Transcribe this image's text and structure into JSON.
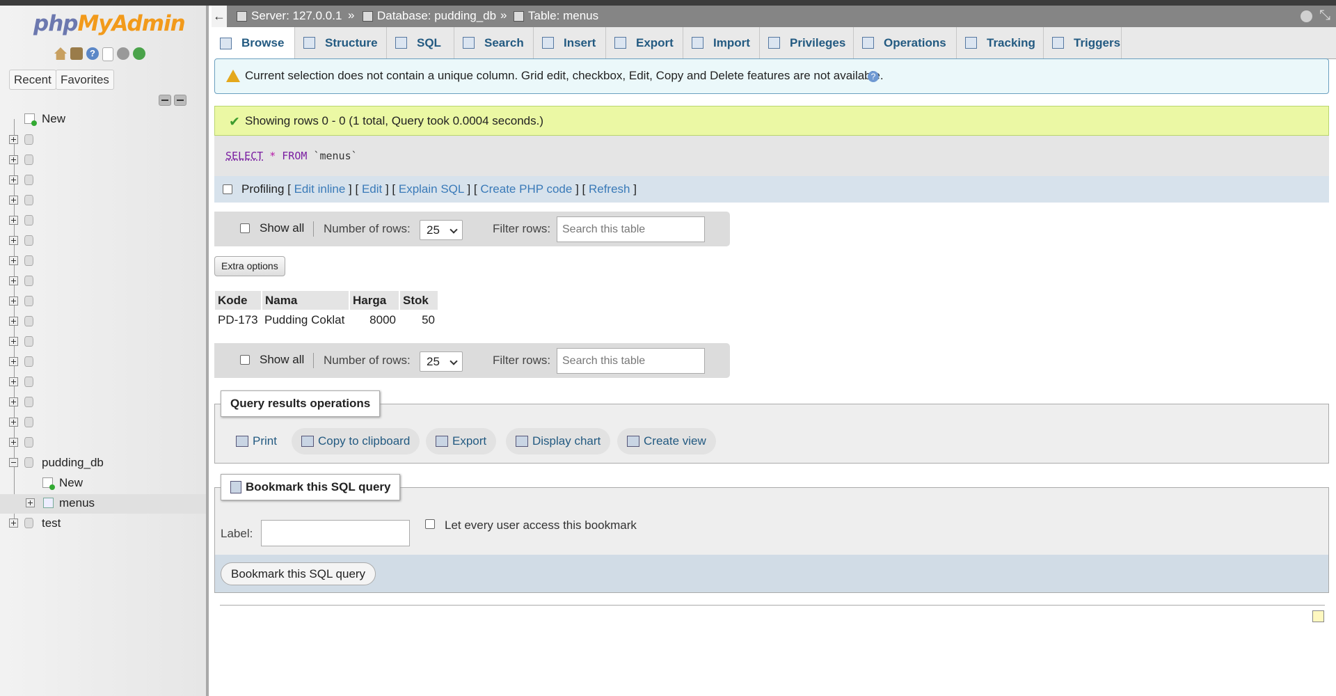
{
  "sidebar": {
    "logo_php": "php",
    "logo_rest": "MyAdmin",
    "recent_label": "Recent",
    "favorites_label": "Favorites",
    "new_label": "New",
    "databases": [
      {
        "name": "pudding_db",
        "children": [
          {
            "name": "New"
          },
          {
            "name": "menus"
          }
        ]
      },
      {
        "name": "test"
      }
    ]
  },
  "breadcrumb": {
    "server": "Server: 127.0.0.1",
    "database": "Database: pudding_db",
    "table": "Table: menus",
    "separator": "»"
  },
  "tabs": [
    "Browse",
    "Structure",
    "SQL",
    "Search",
    "Insert",
    "Export",
    "Import",
    "Privileges",
    "Operations",
    "Tracking",
    "Triggers"
  ],
  "notice": "Current selection does not contain a unique column. Grid edit, checkbox, Edit, Copy and Delete features are not available.",
  "success": "Showing rows 0 - 0 (1 total, Query took 0.0004 seconds.)",
  "sql": {
    "select": "SELECT",
    "star": "*",
    "from": "FROM",
    "table": "`menus`"
  },
  "profiling": {
    "label": "Profiling",
    "edit_inline": "Edit inline",
    "edit": "Edit",
    "explain": "Explain SQL",
    "php_code": "Create PHP code",
    "refresh": "Refresh"
  },
  "nav": {
    "show_all": "Show all",
    "number_of_rows_label": "Number of rows:",
    "rows_value": "25",
    "filter_label": "Filter rows:",
    "filter_placeholder": "Search this table"
  },
  "extra_options": "Extra options",
  "table": {
    "headers": [
      "Kode",
      "Nama",
      "Harga",
      "Stok"
    ],
    "rows": [
      [
        "PD-173",
        "Pudding Coklat",
        "8000",
        "50"
      ]
    ]
  },
  "query_ops": {
    "legend": "Query results operations",
    "print": "Print",
    "copy": "Copy to clipboard",
    "export": "Export",
    "chart": "Display chart",
    "view": "Create view"
  },
  "bookmark": {
    "legend": "Bookmark this SQL query",
    "label": "Label:",
    "share": "Let every user access this bookmark",
    "button": "Bookmark this SQL query"
  }
}
